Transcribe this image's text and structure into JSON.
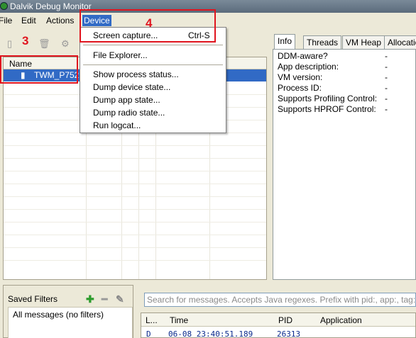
{
  "window": {
    "title": "Dalvik Debug Monitor"
  },
  "menubar": {
    "file": "File",
    "edit": "Edit",
    "actions": "Actions",
    "device": "Device"
  },
  "annotations": {
    "device_list": "3",
    "device_menu": "4"
  },
  "device_menu": {
    "items": [
      {
        "label": "Screen capture...",
        "shortcut": "Ctrl-S"
      },
      {
        "label": "File Explorer..."
      },
      {
        "label": "Show process status..."
      },
      {
        "label": "Dump device state..."
      },
      {
        "label": "Dump app state..."
      },
      {
        "label": "Dump radio state..."
      },
      {
        "label": "Run logcat..."
      }
    ]
  },
  "devices": {
    "header": "Name",
    "rows": [
      {
        "name": "TWM_P752"
      }
    ]
  },
  "info_tabs": [
    "Info",
    "Threads",
    "VM Heap",
    "Allocation"
  ],
  "info": [
    {
      "label": "DDM-aware?",
      "value": "-"
    },
    {
      "label": "App description:",
      "value": "-"
    },
    {
      "label": "VM version:",
      "value": "-"
    },
    {
      "label": "Process ID:",
      "value": "-"
    },
    {
      "label": "Supports Profiling Control:",
      "value": "-"
    },
    {
      "label": "Supports HPROF Control:",
      "value": "-"
    }
  ],
  "saved_filters": {
    "title": "Saved Filters",
    "items": [
      "All messages (no filters)"
    ]
  },
  "search": {
    "placeholder": "Search for messages. Accepts Java regexes. Prefix with pid:, app:, tag: or text:"
  },
  "log": {
    "columns": [
      "L...",
      "Time",
      "PID",
      "Application"
    ],
    "rows": [
      {
        "level": "D",
        "time": "06-08 23:40:51.189",
        "pid": "26313",
        "app": ""
      }
    ]
  },
  "colors": {
    "annotation": "#e0141e",
    "selection": "#316ac5"
  }
}
